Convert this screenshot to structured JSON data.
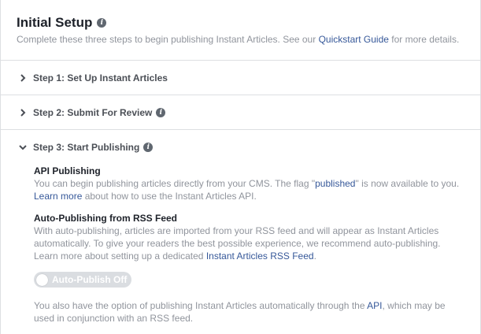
{
  "header": {
    "title": "Initial Setup",
    "subtitle_before": "Complete these three steps to begin publishing Instant Articles. See our ",
    "subtitle_link": "Quickstart Guide",
    "subtitle_after": " for more details."
  },
  "steps": [
    {
      "label": "Step 1: Set Up Instant Articles",
      "has_info": false,
      "expanded": false
    },
    {
      "label": "Step 2: Submit For Review",
      "has_info": true,
      "expanded": false
    },
    {
      "label": "Step 3: Start Publishing",
      "has_info": true,
      "expanded": true
    }
  ],
  "api_publishing": {
    "title": "API Publishing",
    "text_1": "You can begin publishing articles directly from your CMS. The flag \"",
    "flag_link": "published",
    "text_2": "\" is now available to you. ",
    "learn_more_link": "Learn more",
    "text_3": " about how to use the Instant Articles API."
  },
  "rss": {
    "title": "Auto-Publishing from RSS Feed",
    "text_1": "With auto-publishing, articles are imported from your RSS feed and will appear as Instant Articles automatically. To give your readers the best possible experience, we recommend auto-publishing. Learn more about setting up a dedicated ",
    "rss_link": "Instant Articles RSS Feed",
    "text_2": "."
  },
  "toggle": {
    "label": "Auto-Publish Off",
    "on": false
  },
  "footer": {
    "text_1": "You also have the option of publishing Instant Articles automatically through the ",
    "api_link": "API",
    "text_2": ", which may be used in conjunction with an RSS feed."
  },
  "colors": {
    "link": "#365899",
    "muted": "#90949c",
    "divider": "#dddfe2"
  },
  "icons": {
    "info": "info-icon",
    "collapsed": "chevron-right-icon",
    "expanded": "chevron-down-icon"
  }
}
